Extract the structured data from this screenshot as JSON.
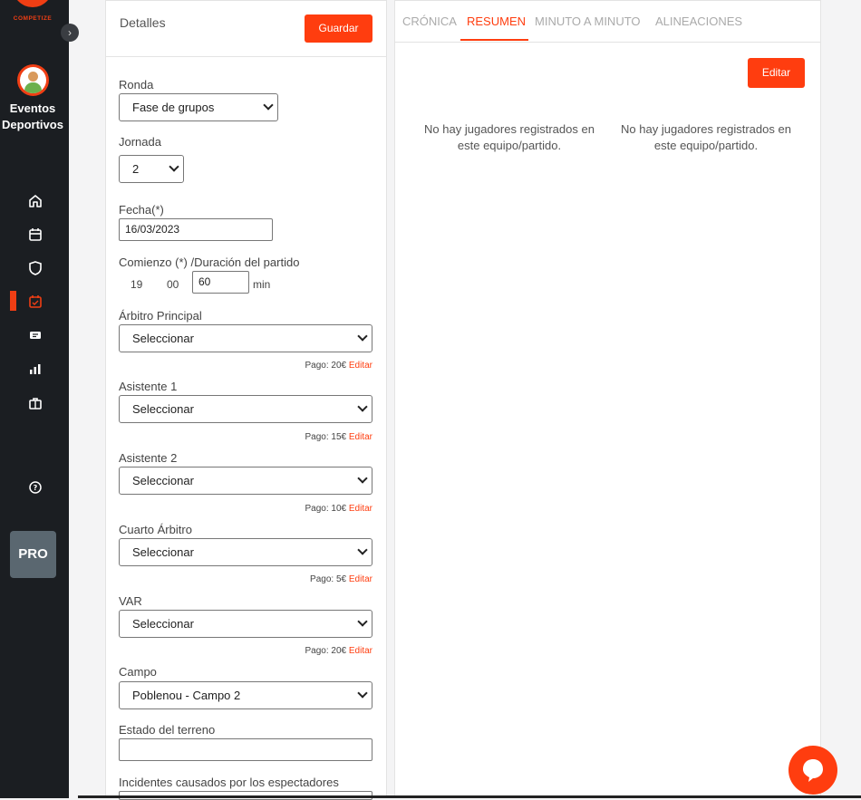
{
  "sidebar": {
    "logo_text": "COMPETIZE",
    "org_name_line1": "Eventos",
    "org_name_line2": "Deportivos",
    "nav_icons": [
      "home-icon",
      "calendar-icon",
      "shield-icon",
      "match-icon",
      "ticket-icon",
      "stats-icon",
      "briefcase-icon"
    ],
    "help_icon": "help-icon",
    "pro_label": "PRO",
    "accent": "#f03e14"
  },
  "details": {
    "title": "Detalles",
    "save_label": "Guardar",
    "ronda_label": "Ronda",
    "ronda_value": "Fase de grupos",
    "jornada_label": "Jornada",
    "jornada_value": "2",
    "fecha_label": "Fecha(*)",
    "fecha_value": "16/03/2023",
    "comienzo_label": "Comienzo (*) /Duración del partido",
    "hour": "19",
    "minute": "00",
    "duration": "60",
    "duration_unit": "min",
    "arbitro_label": "Árbitro Principal",
    "arbitro_value": "Seleccionar",
    "arbitro_pago": "Pago: 20€",
    "asistente1_label": "Asistente 1",
    "asistente1_value": "Seleccionar",
    "asistente1_pago": "Pago: 15€",
    "asistente2_label": "Asistente 2",
    "asistente2_value": "Seleccionar",
    "asistente2_pago": "Pago: 10€",
    "cuarto_label": "Cuarto Árbitro",
    "cuarto_value": "Seleccionar",
    "cuarto_pago": "Pago: 5€",
    "var_label": "VAR",
    "var_value": "Seleccionar",
    "var_pago": "Pago: 20€",
    "edit_link": "Editar",
    "campo_label": "Campo",
    "campo_value": "Poblenou - Campo 2",
    "estado_label": "Estado del terreno",
    "estado_value": "",
    "incidentes_label": "Incidentes causados por los espectadores"
  },
  "summary": {
    "tabs": [
      "CRÓNICA",
      "RESUMEN",
      "MINUTO A MINUTO",
      "ALINEACIONES"
    ],
    "active_tab": "RESUMEN",
    "edit_label": "Editar",
    "empty_home": "No hay jugadores registrados en este equipo/partido.",
    "empty_away": "No hay jugadores registrados en este equipo/partido."
  }
}
